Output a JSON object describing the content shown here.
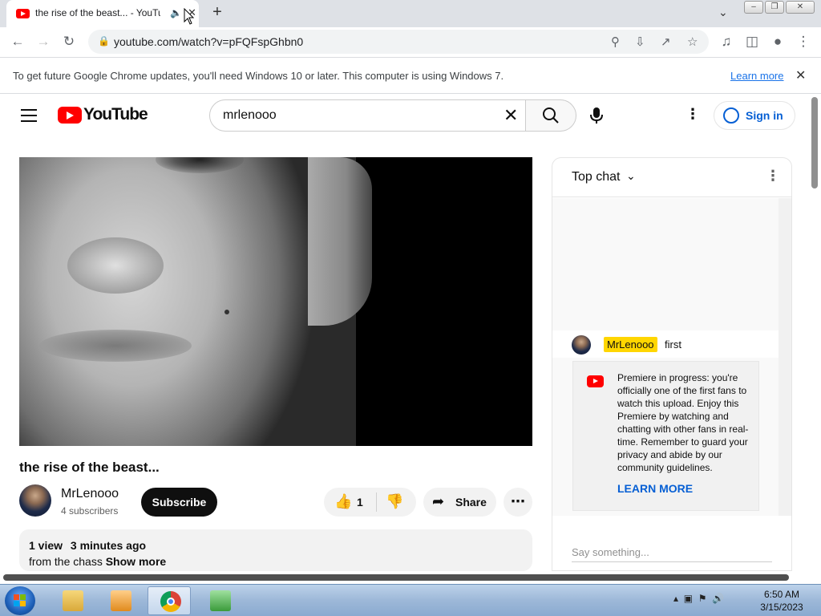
{
  "browser": {
    "tab_title": "the rise of the beast... - YouTube",
    "new_tab_label": "+",
    "url": "youtube.com/watch?v=pFQFspGhbn0",
    "infobar_message": "To get future Google Chrome updates, you'll need Windows 10 or later. This computer is using Windows 7.",
    "infobar_link": "Learn more"
  },
  "youtube": {
    "logo_text": "YouTube",
    "search_query": "mrlenooo",
    "signin_label": "Sign in",
    "video": {
      "title": "the rise of the beast...",
      "channel_name": "MrLenooo",
      "subscribers": "4 subscribers",
      "subscribe_label": "Subscribe",
      "like_count": "1",
      "share_label": "Share",
      "views": "1 view",
      "uploaded": "3 minutes ago",
      "description_text": "from the chass",
      "show_more_label": "Show more"
    },
    "chat": {
      "header_label": "Top chat",
      "message_author": "MrLenooo",
      "message_text": "first",
      "notice_text": "Premiere in progress: you're officially one of the first fans to watch this upload. Enjoy this Premiere by watching and chatting with other fans in real-time. Remember to guard your privacy and abide by our community guidelines.",
      "notice_link": "LEARN MORE",
      "input_placeholder": "Say something..."
    }
  },
  "taskbar": {
    "time": "6:50 AM",
    "date": "3/15/2023"
  },
  "colors": {
    "youtube_red": "#ff0000",
    "link_blue": "#065fd4",
    "chrome_link": "#1a73e8",
    "author_highlight": "#ffd600"
  }
}
